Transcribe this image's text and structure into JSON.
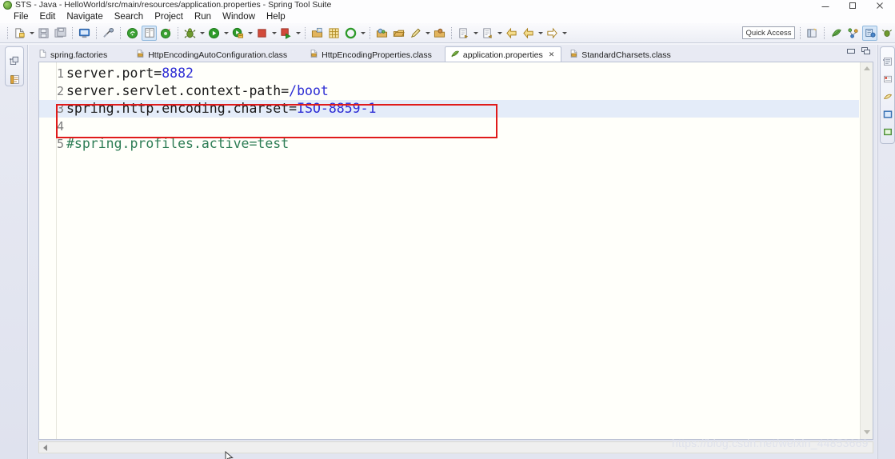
{
  "window": {
    "title": "STS - Java - HelloWorld/src/main/resources/application.properties - Spring Tool Suite",
    "app_icon": "sts-logo-icon",
    "controls": {
      "minimize": "minimize-button",
      "maximize": "maximize-button",
      "close": "close-button"
    }
  },
  "menubar": {
    "items": [
      {
        "label": "File",
        "mnemonic": "F"
      },
      {
        "label": "Edit",
        "mnemonic": "E"
      },
      {
        "label": "Navigate",
        "mnemonic": "N"
      },
      {
        "label": "Search",
        "mnemonic": "a"
      },
      {
        "label": "Project",
        "mnemonic": "P"
      },
      {
        "label": "Run",
        "mnemonic": "R"
      },
      {
        "label": "Window",
        "mnemonic": "W"
      },
      {
        "label": "Help",
        "mnemonic": "H"
      }
    ]
  },
  "toolbar": {
    "quick_access_placeholder": "Quick Access",
    "quick_access_value": "",
    "groups": [
      {
        "name": "new-group",
        "buttons": [
          {
            "icon": "new-file-icon",
            "dropdown": true
          },
          {
            "icon": "save-icon",
            "dropdown": false
          },
          {
            "icon": "save-all-icon",
            "dropdown": false
          }
        ]
      },
      {
        "name": "console-group",
        "buttons": [
          {
            "icon": "open-console-icon",
            "dropdown": false
          }
        ]
      },
      {
        "name": "marker-group",
        "buttons": [
          {
            "icon": "skip-breakpoints-icon",
            "dropdown": false
          }
        ]
      },
      {
        "name": "boot-group",
        "buttons": [
          {
            "icon": "boot-dashboard-icon",
            "dropdown": false
          },
          {
            "icon": "toggle-mark-occurrences-icon",
            "dropdown": false,
            "selected": true
          },
          {
            "icon": "spring-boot-app-icon",
            "dropdown": false
          }
        ]
      },
      {
        "name": "run-group",
        "buttons": [
          {
            "icon": "debug-icon",
            "dropdown": true
          },
          {
            "icon": "run-icon",
            "dropdown": true
          },
          {
            "icon": "run-external-tools-icon",
            "dropdown": true
          },
          {
            "icon": "terminate-icon",
            "dropdown": true
          },
          {
            "icon": "relaunch-icon",
            "dropdown": true
          }
        ]
      },
      {
        "name": "java-group",
        "buttons": [
          {
            "icon": "new-java-package-icon",
            "dropdown": false
          },
          {
            "icon": "new-java-class-icon",
            "dropdown": false
          },
          {
            "icon": "new-grid-icon",
            "dropdown": false
          },
          {
            "icon": "refresh-gradle-icon",
            "dropdown": true
          }
        ]
      },
      {
        "name": "search-group",
        "buttons": [
          {
            "icon": "search-icon",
            "dropdown": false
          },
          {
            "icon": "open-task-icon",
            "dropdown": false
          },
          {
            "icon": "pencil-icon",
            "dropdown": true
          },
          {
            "icon": "open-type-icon",
            "dropdown": false
          }
        ]
      },
      {
        "name": "nav-group",
        "buttons": [
          {
            "icon": "next-annotation-icon",
            "dropdown": true
          },
          {
            "icon": "previous-annotation-icon",
            "dropdown": true
          },
          {
            "icon": "back-history-icon",
            "dropdown": false
          },
          {
            "icon": "forward-back-icon",
            "dropdown": true
          },
          {
            "icon": "forward-history-icon",
            "dropdown": true
          }
        ]
      }
    ],
    "perspective_buttons": [
      {
        "icon": "open-perspective-icon"
      },
      {
        "icon": "spring-perspective-icon"
      },
      {
        "icon": "java-ee-perspective-icon"
      },
      {
        "icon": "java-perspective-icon",
        "selected": true
      },
      {
        "icon": "debug-perspective-icon"
      }
    ]
  },
  "left_sidebar": {
    "name": "minimized-view-stack",
    "icons": [
      {
        "icon": "restore-view-icon"
      },
      {
        "icon": "package-explorer-icon"
      }
    ]
  },
  "right_sidebar": {
    "name": "minimized-view-stack-right",
    "icons": [
      {
        "icon": "outline-view-icon"
      },
      {
        "icon": "problems-view-icon"
      },
      {
        "icon": "javadoc-view-icon"
      },
      {
        "icon": "boot-dashboard-view-icon"
      },
      {
        "icon": "console-view-icon"
      }
    ]
  },
  "editor": {
    "tabs": [
      {
        "label": "spring.factories",
        "icon": "file-icon",
        "active": false,
        "closable": false
      },
      {
        "label": "HttpEncodingAutoConfiguration.class",
        "icon": "class-file-icon",
        "active": false,
        "closable": false
      },
      {
        "label": "HttpEncodingProperties.class",
        "icon": "class-file-icon",
        "active": false,
        "closable": false
      },
      {
        "label": "application.properties",
        "icon": "properties-leaf-icon",
        "active": true,
        "closable": true,
        "close_glyph": "✕"
      },
      {
        "label": "StandardCharsets.class",
        "icon": "class-file-icon",
        "active": false,
        "closable": false
      }
    ],
    "view_buttons": [
      {
        "icon": "minimize-view-icon"
      },
      {
        "icon": "maximize-view-icon"
      }
    ],
    "lines": [
      {
        "number": "1",
        "segments": [
          {
            "text": "server.port=",
            "kind": "key"
          },
          {
            "text": "8882",
            "kind": "value"
          }
        ],
        "highlighted": false
      },
      {
        "number": "2",
        "segments": [
          {
            "text": "server.servlet.context-path=",
            "kind": "key"
          },
          {
            "text": "/boot",
            "kind": "value"
          }
        ],
        "highlighted": false
      },
      {
        "number": "3",
        "segments": [
          {
            "text": "spring.http.encoding.charset=",
            "kind": "key"
          },
          {
            "text": "ISO-8859-1",
            "kind": "value"
          }
        ],
        "highlighted": true
      },
      {
        "number": "4",
        "segments": [
          {
            "text": "",
            "kind": "key"
          }
        ],
        "highlighted": false
      },
      {
        "number": "5",
        "segments": [
          {
            "text": "#spring.profiles.active=test",
            "kind": "comment"
          }
        ],
        "highlighted": false
      }
    ],
    "scrollbars": {
      "vertical": "vertical-scrollbar",
      "horizontal": "horizontal-scrollbar"
    }
  },
  "annotation": {
    "type": "red-rectangle-highlight",
    "color": "#e01b1b",
    "targets_line": "3"
  },
  "watermark": {
    "text": "https://blog.csdn.net/weixin_44853669"
  },
  "colors": {
    "value_blue": "#2c2cd4",
    "comment_green": "#2e7d55",
    "line_highlight": "#e4ecf9",
    "annotation_red": "#e01b1b",
    "chrome": "#e8eaf3"
  }
}
